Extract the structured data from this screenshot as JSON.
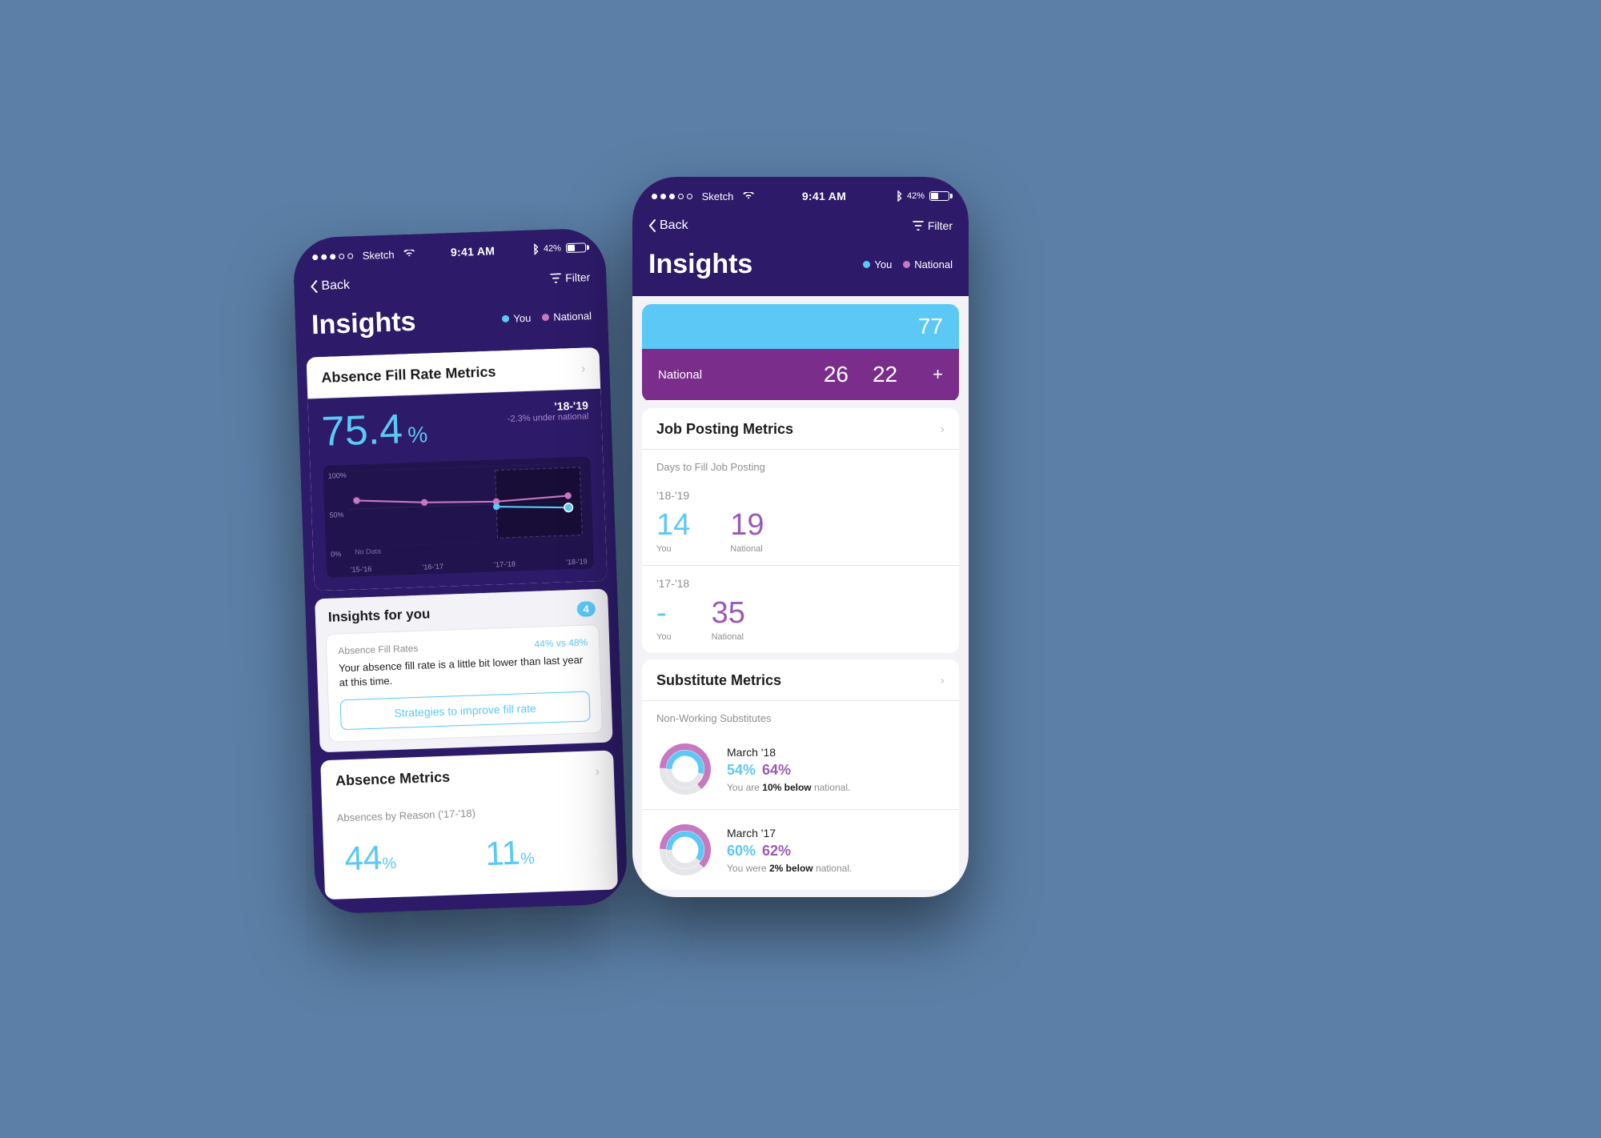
{
  "app": {
    "status_bar": {
      "dots": [
        "filled",
        "filled",
        "filled",
        "empty",
        "empty"
      ],
      "network": "Sketch",
      "wifi": "wifi",
      "time": "9:41 AM",
      "bluetooth": "42%"
    },
    "nav": {
      "back_label": "Back",
      "filter_label": "Filter"
    }
  },
  "left_phone": {
    "title": "Insights",
    "legend": {
      "you_label": "You",
      "you_color": "#5bc8f5",
      "national_label": "National",
      "national_color": "#c678c0"
    },
    "absence_fill_card": {
      "title": "Absence Fill Rate Metrics",
      "big_number": "75.4",
      "percent": "%",
      "period": "'18-'19",
      "under_national": "-2.3% under national",
      "chart": {
        "y_labels": [
          "100%",
          "50%",
          "0%"
        ],
        "x_labels": [
          "'15-'16",
          "'16-'17",
          "'17-'18",
          "'18-'19"
        ],
        "no_data_label": "No Data"
      }
    },
    "insights_card": {
      "title": "Insights for you",
      "count": "4",
      "insight": {
        "label": "Absence Fill Rates",
        "value": "44% vs 48%",
        "text": "Your absence fill rate is a little bit lower than last year at this time.",
        "button": "Strategies to improve fill rate"
      }
    },
    "absence_metrics_card": {
      "title": "Absence Metrics",
      "subtitle": "Absences by Reason ('17-'18)",
      "metrics": [
        {
          "value": "44",
          "percent": "%"
        },
        {
          "value": "11",
          "percent": "%"
        }
      ]
    }
  },
  "right_phone": {
    "title": "Insights",
    "legend": {
      "you_label": "You",
      "you_color": "#5bc8f5",
      "national_label": "National",
      "national_color": "#c678c0"
    },
    "nav": {
      "back_label": "Back",
      "filter_label": "Filter"
    },
    "top_partial": {
      "you_value": "77",
      "national_label": "National",
      "national_val1": "26",
      "national_val2": "22",
      "plus": "+"
    },
    "job_posting_card": {
      "title": "Job Posting Metrics",
      "subtitle": "Days to Fill Job Posting",
      "rows": [
        {
          "year": "'18-'19",
          "you_value": "14",
          "you_label": "You",
          "national_value": "19",
          "national_label": "National"
        },
        {
          "year": "'17-'18",
          "you_value": "-",
          "you_label": "You",
          "national_value": "35",
          "national_label": "National"
        }
      ]
    },
    "substitute_card": {
      "title": "Substitute Metrics",
      "subtitle": "Non-Working Substitutes",
      "rows": [
        {
          "period": "March '18",
          "you_pct": "54%",
          "national_pct": "64%",
          "note": "You are ",
          "emphasis": "10% below",
          "note_end": " national.",
          "you_arc": 54,
          "nat_arc": 64
        },
        {
          "period": "March '17",
          "you_pct": "60%",
          "national_pct": "62%",
          "note": "You were ",
          "emphasis": "2% below",
          "note_end": " national.",
          "you_arc": 60,
          "nat_arc": 62
        }
      ]
    }
  }
}
